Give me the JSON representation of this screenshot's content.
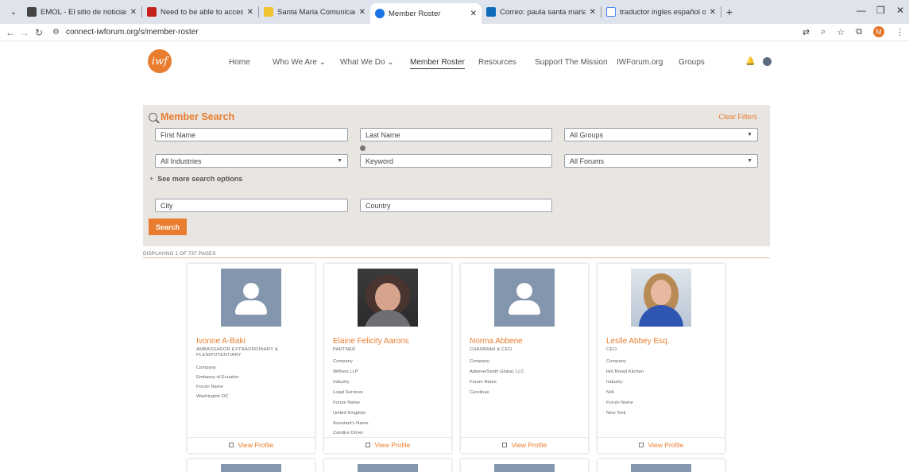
{
  "browser": {
    "tabs": [
      {
        "title": "EMOL - El sitio de noticias onli",
        "favicon": "#444444"
      },
      {
        "title": "Need to be able to access IWF",
        "favicon": "#c5221f"
      },
      {
        "title": "Santa Maria Comunicaciones -",
        "favicon": "#f1c232"
      },
      {
        "title": "Member Roster",
        "favicon": "#1a73e8"
      },
      {
        "title": "Correo: paula santa maria - Out",
        "favicon": "#0f6cbd"
      },
      {
        "title": "traductor ingles español online",
        "favicon": "#4285f4"
      }
    ],
    "url": "connect-iwforum.org/s/member-roster",
    "profile_initial": "M"
  },
  "nav": {
    "logo": "iwf",
    "items": [
      "Home",
      "Who We Are",
      "What We Do",
      "Member Roster",
      "Resources",
      "Support The Mission",
      "IWForum.org",
      "Groups"
    ]
  },
  "search": {
    "title": "Member Search",
    "clear_label": "Clear Filters",
    "first_name": "First Name",
    "last_name": "Last Name",
    "groups": "All Groups",
    "industries": "All Industries",
    "keyword": "Keyword",
    "forums": "All Forums",
    "more_options": "See more search options",
    "city": "City",
    "country": "Country",
    "search_label": "Search"
  },
  "displaying": "DISPLAYING 1 OF 737 PAGES",
  "members": [
    {
      "name": "Ivonne A-Baki",
      "title_lines": [
        "AMBASSADOR EXTRAORDINARY &",
        "PLENIPOTENTIARY"
      ],
      "fields": [
        "Company",
        "Embassy of Ecuador",
        "Forum Name",
        "Washington DC"
      ],
      "has_photo": false
    },
    {
      "name": "Elaine Felicity Aarons",
      "title_lines": [
        "PARTNER"
      ],
      "fields": [
        "Company",
        "Withers LLP",
        "Industry",
        "Legal Services",
        "Forum Name",
        "United Kingdom",
        "Assistant's Name",
        "Candice Driver"
      ],
      "has_photo": true
    },
    {
      "name": "Norma Abbene",
      "title_lines": [
        "CHAIRMAN & CEO"
      ],
      "fields": [
        "Company",
        "Abbene/Smith Global, LLC",
        "Forum Name",
        "Carolinas"
      ],
      "has_photo": false
    },
    {
      "name": "Leslie Abbey Esq.",
      "title_lines": [
        "CEO"
      ],
      "fields": [
        "Company",
        "Hot Bread Kitchen",
        "Industry",
        "N/A",
        "Forum Name",
        "New York"
      ],
      "has_photo": true
    }
  ],
  "view_profile_label": "View Profile",
  "colors": {
    "accent": "#e87d2f",
    "panel": "#e9e6e2",
    "avatar": "#8396ad"
  }
}
